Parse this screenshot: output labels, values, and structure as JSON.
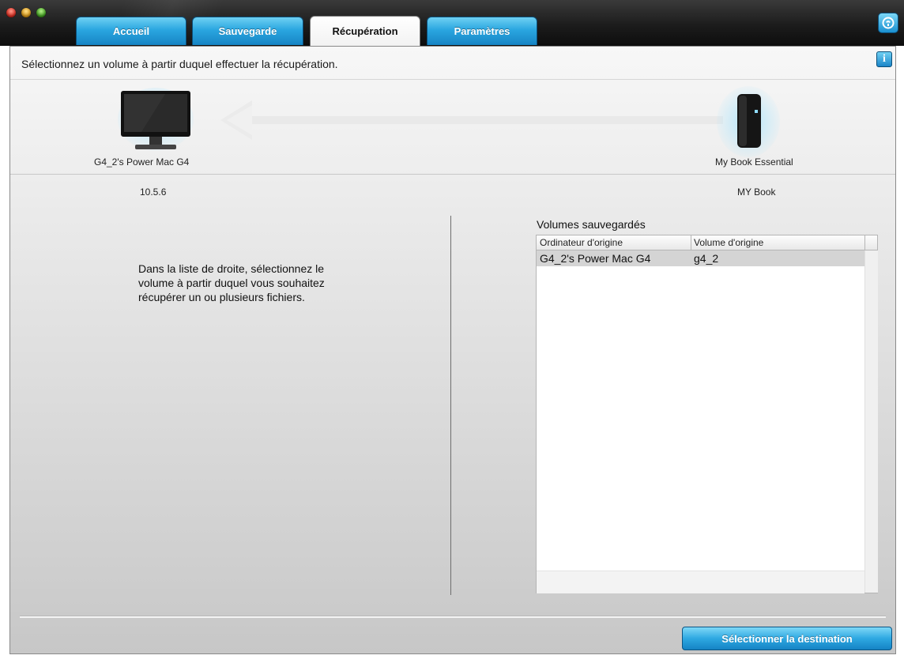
{
  "tabs": [
    {
      "label": "Accueil",
      "active": false
    },
    {
      "label": "Sauvegarde",
      "active": false
    },
    {
      "label": "Récupération",
      "active": true
    },
    {
      "label": "Paramètres",
      "active": false
    }
  ],
  "header": {
    "instruction": "Sélectionnez un volume à partir duquel effectuer la récupération."
  },
  "source": {
    "name": "G4_2's Power Mac G4",
    "version": "10.5.6"
  },
  "destination": {
    "name": "My Book Essential",
    "volume": "MY Book"
  },
  "hint": "Dans la liste de droite, sélectionnez le volume à partir duquel vous souhaitez récupérer un ou plusieurs fichiers.",
  "volumes": {
    "title": "Volumes sauvegardés",
    "columns": [
      "Ordinateur d'origine",
      "Volume d'origine"
    ],
    "rows": [
      {
        "computer": "G4_2's Power Mac G4",
        "volume": "g4_2",
        "selected": true
      }
    ]
  },
  "actions": {
    "select_destination": "Sélectionner la destination"
  },
  "colors": {
    "accent": "#2aa6e0",
    "titlebar": "#1c1c1c",
    "selected_row": "#d4d4d4"
  }
}
